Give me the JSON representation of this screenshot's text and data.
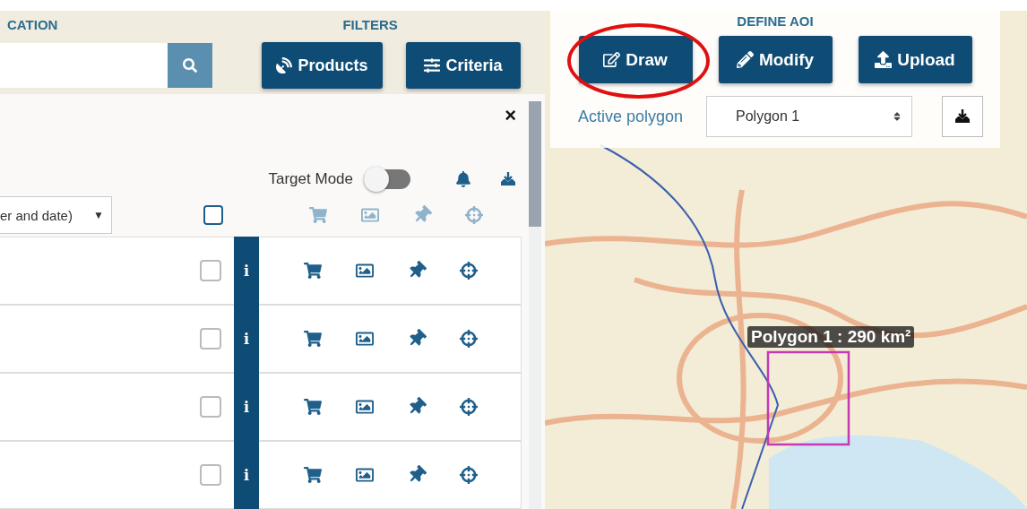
{
  "header": {
    "location_label": "CATION",
    "filters_label": "FILTERS"
  },
  "filter_buttons": [
    {
      "label": "Products",
      "kind": "products"
    },
    {
      "label": "Criteria",
      "kind": "criteria"
    }
  ],
  "results_panel": {
    "close": "×",
    "target_mode": {
      "label": "Target Mode",
      "on": false
    },
    "sort": {
      "value": "er and date)",
      "caret": "▼"
    },
    "select_all": {
      "checked": false
    },
    "rows": [
      {
        "checked": false,
        "info": "i"
      },
      {
        "checked": false,
        "info": "i"
      },
      {
        "checked": false,
        "info": "i"
      },
      {
        "checked": false,
        "info": "i"
      }
    ]
  },
  "aoi": {
    "title": "DEFINE AOI",
    "buttons": [
      {
        "label": "Draw",
        "kind": "draw",
        "highlighted": true
      },
      {
        "label": "Modify",
        "kind": "modify",
        "highlighted": false
      },
      {
        "label": "Upload",
        "kind": "upload",
        "highlighted": false
      }
    ],
    "active_polygon": {
      "label": "Active polygon",
      "value": "Polygon 1"
    }
  },
  "map": {
    "polygon_label": "Polygon 1 : 290 km²"
  }
}
